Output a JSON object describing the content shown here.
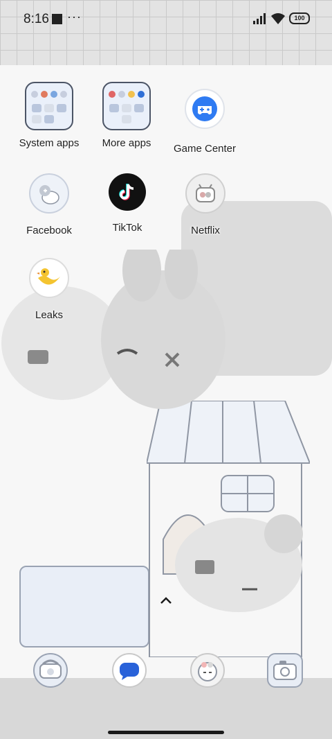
{
  "status_bar": {
    "time": "8:16",
    "overflow": "···",
    "battery": "100"
  },
  "apps": [
    {
      "label": "System apps",
      "icon": "folder-icon"
    },
    {
      "label": "More apps",
      "icon": "folder-icon"
    },
    {
      "label": "Game Center",
      "icon": "game-controller-icon"
    },
    {
      "label": "Facebook",
      "icon": "facebook-icon"
    },
    {
      "label": "TikTok",
      "icon": "tiktok-icon"
    },
    {
      "label": "Netflix",
      "icon": "netflix-icon"
    },
    {
      "label": "Leaks",
      "icon": "leaks-icon"
    }
  ],
  "dock": [
    {
      "icon": "phone-icon"
    },
    {
      "icon": "messages-icon"
    },
    {
      "icon": "browser-icon"
    },
    {
      "icon": "camera-icon"
    }
  ],
  "colors": {
    "game_center": "#2f7bf2",
    "tiktok": "#111111",
    "messages": "#2962d9",
    "leaks": "#f4c430"
  }
}
